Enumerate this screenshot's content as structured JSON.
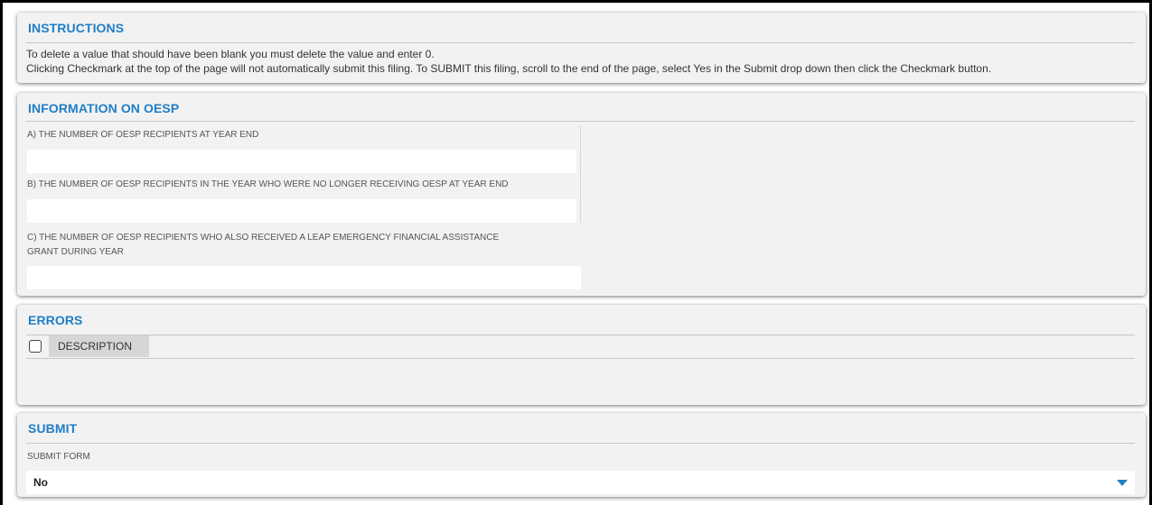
{
  "instructions": {
    "title": "INSTRUCTIONS",
    "lines": [
      "To delete a value that should have been blank you must delete the value and enter 0.",
      "Clicking Checkmark at the top of the page will not automatically submit this filing. To SUBMIT this filing, scroll to the end of the page, select Yes in the Submit drop down then click the Checkmark button."
    ]
  },
  "oesp": {
    "title": "INFORMATION ON OESP",
    "fields": [
      {
        "label": "A) THE NUMBER OF OESP RECIPIENTS AT YEAR END",
        "value": ""
      },
      {
        "label": "B) THE NUMBER OF OESP RECIPIENTS IN THE YEAR WHO WERE NO LONGER RECEIVING OESP AT YEAR END",
        "value": ""
      },
      {
        "label_line1": "C) THE NUMBER OF OESP RECIPIENTS WHO ALSO RECEIVED A LEAP EMERGENCY FINANCIAL ASSISTANCE",
        "label_line2": "GRANT DURING YEAR",
        "value": ""
      }
    ]
  },
  "errors": {
    "title": "ERRORS",
    "columns": [
      "DESCRIPTION"
    ],
    "select_all_checked": false,
    "rows": []
  },
  "submit": {
    "title": "SUBMIT",
    "field_label": "SUBMIT FORM",
    "selected": "No"
  },
  "colors": {
    "accent": "#1f7ec6",
    "panel_bg": "#f2f2f2",
    "header_bg": "#d6d6d6"
  },
  "icons": {
    "dropdown": "caret-down-icon",
    "checkbox": "checkbox-icon"
  }
}
